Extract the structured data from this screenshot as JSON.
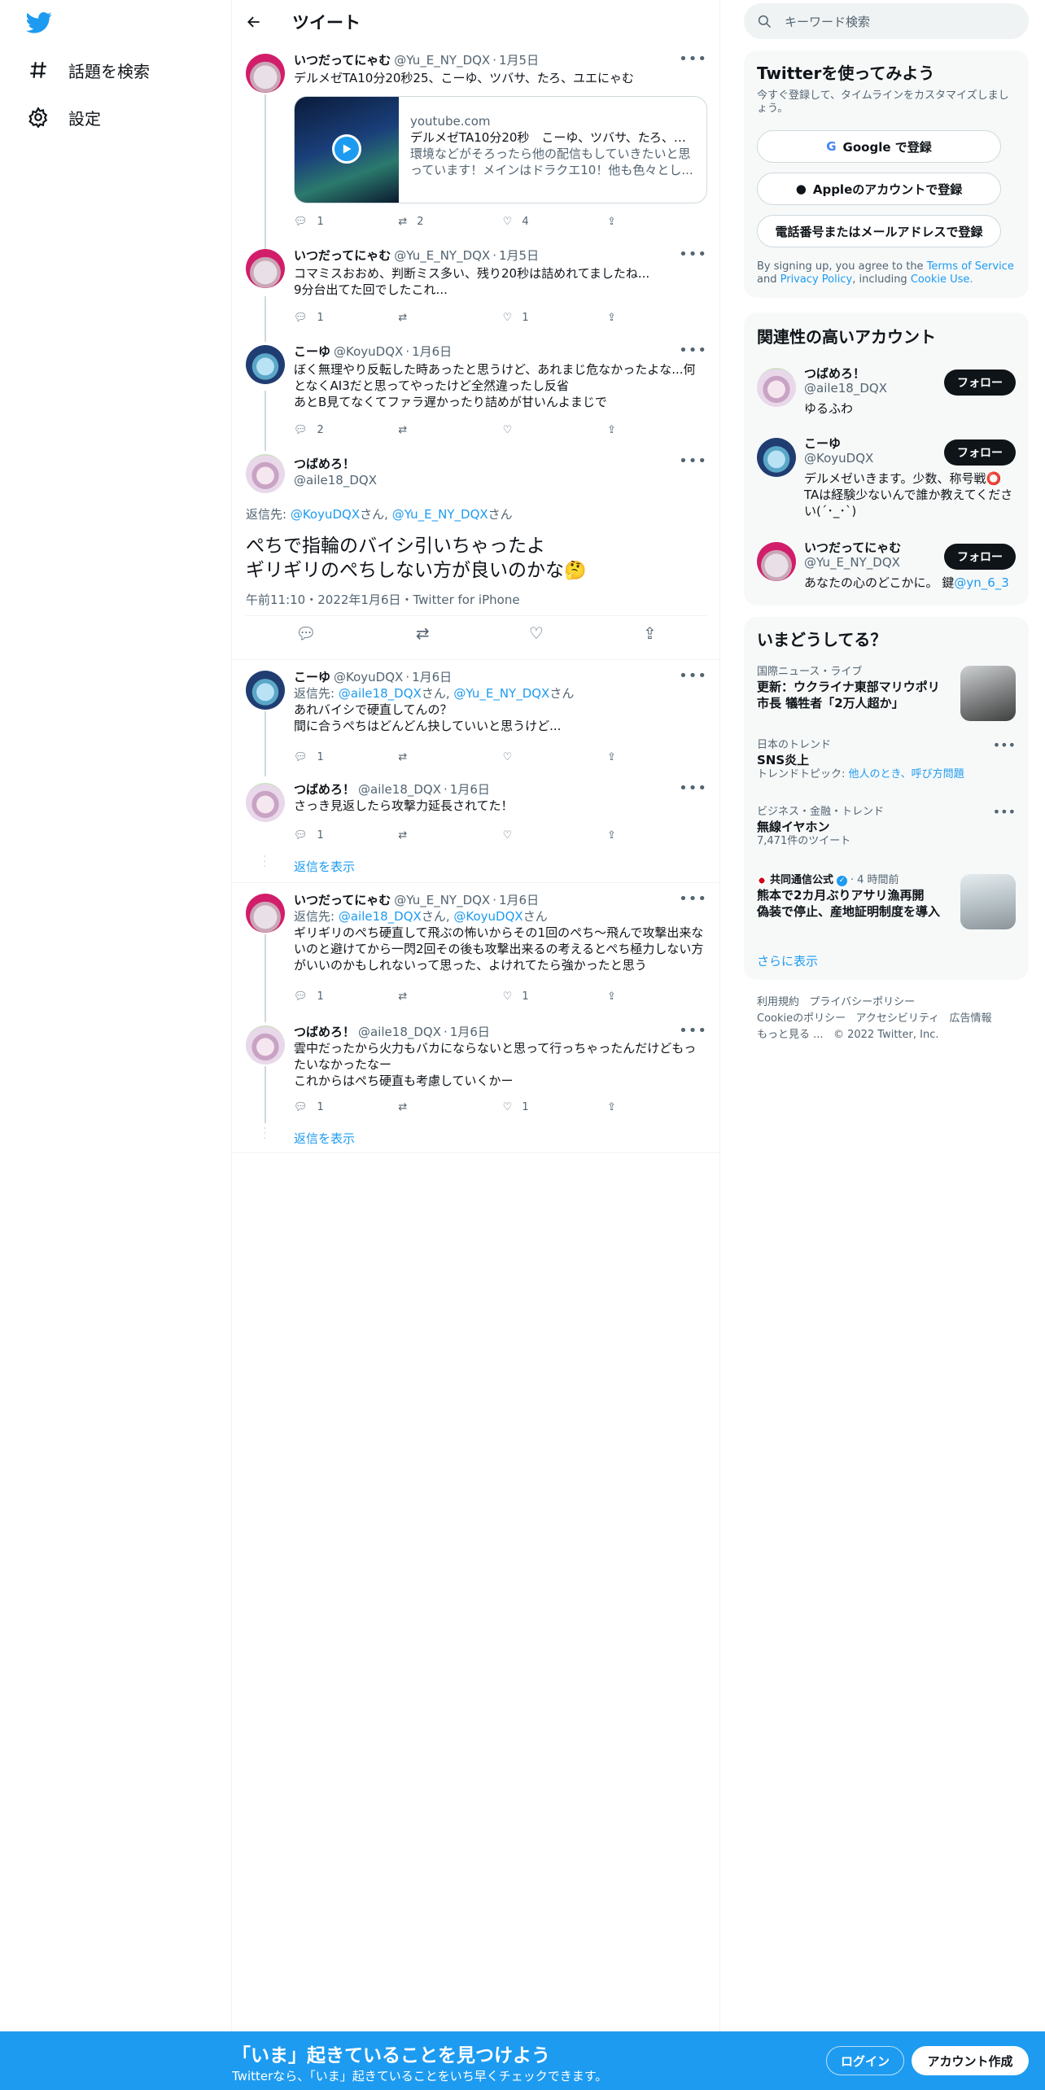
{
  "nav": {
    "explore_label": "話題を検索",
    "settings_label": "設定"
  },
  "header": {
    "title": "ツイート"
  },
  "tweets": [
    {
      "name": "いつだってにゃむ",
      "handle": "@Yu_E_NY_DQX",
      "date": "1月5日",
      "text": "デルメゼTA10分20秒25、こーゆ、ツバサ、たろ、ユエにゃむ",
      "card": {
        "domain": "youtube.com",
        "title": "デルメゼTA10分20秒　こーゆ、ツバサ、たろ、ユ...",
        "desc": "環境などがそろったら他の配信もしていきたいと思っています！メインはドラクエ10！他も色々とし..."
      },
      "replies": "1",
      "retweets": "2",
      "likes": "4"
    },
    {
      "name": "いつだってにゃむ",
      "handle": "@Yu_E_NY_DQX",
      "date": "1月5日",
      "text": "コマミスおおめ、判断ミス多い、残り20秒は詰めれてましたね...\n9分台出てた回でしたこれ...",
      "replies": "1",
      "retweets": "",
      "likes": "1"
    },
    {
      "name": "こーゆ",
      "handle": "@KoyuDQX",
      "date": "1月6日",
      "text": "ぼく無理やり反転した時あったと思うけど、あれまじ危なかったよな...何となくAI3だと思ってやったけど全然違ったし反省\nあとB見てなくてファラ遅かったり詰めが甘いんよまじで",
      "replies": "2",
      "retweets": "",
      "likes": ""
    }
  ],
  "main_tweet": {
    "name": "つばめろ！",
    "handle": "@aile18_DQX",
    "reply_prefix": "返信先:",
    "reply_user1": "@KoyuDQX",
    "reply_san1": "さん,",
    "reply_user2": "@Yu_E_NY_DQX",
    "reply_san2": "さん",
    "text": "ぺちで指輪のバイシ引いちゃったよ\nギリギリのぺちしない方が良いのかな",
    "emoji": "🤔",
    "meta": "午前11:10・2022年1月6日・Twitter for iPhone"
  },
  "replies": [
    {
      "name": "こーゆ",
      "handle": "@KoyuDQX",
      "date": "1月6日",
      "reply_prefix": "返信先:",
      "reply_user1": "@aile18_DQX",
      "reply_san1": "さん,",
      "reply_user2": "@Yu_E_NY_DQX",
      "reply_san2": "さん",
      "text": "あれバイシで硬直してんの？\n間に合うぺちはどんどん抉していいと思うけど...",
      "replies": "1"
    },
    {
      "name": "つばめろ！",
      "handle": "@aile18_DQX",
      "date": "1月6日",
      "text": "さっき見返したら攻撃力延長されてた！",
      "replies": "1"
    },
    {
      "name": "いつだってにゃむ",
      "handle": "@Yu_E_NY_DQX",
      "date": "1月6日",
      "reply_prefix": "返信先:",
      "reply_user1": "@aile18_DQX",
      "reply_san1": "さん,",
      "reply_user2": "@KoyuDQX",
      "reply_san2": "さん",
      "text": "ギリギリのぺち硬直して飛ぶの怖いからその1回のぺち～飛んで攻撃出来ないのと避けてから一閃2回その後も攻撃出来るの考えるとぺち極力しない方がいいのかもしれないって思った、よけれてたら強かったと思う",
      "replies": "1",
      "likes": "1"
    },
    {
      "name": "つばめろ！",
      "handle": "@aile18_DQX",
      "date": "1月6日",
      "text": "雲中だったから火力もバカにならないと思って行っちゃったんだけどもったいなかったなー\nこれからはぺち硬直も考慮していくかー",
      "replies": "1",
      "likes": "1"
    }
  ],
  "show_replies_label": "返信を表示",
  "search": {
    "placeholder": "キーワード検索"
  },
  "signup_panel": {
    "title": "Twitterを使ってみよう",
    "subtitle": "今すぐ登録して、タイムラインをカスタマイズしましょう。",
    "google": "Google で登録",
    "apple": "Appleのアカウントで登録",
    "phone": "電話番号またはメールアドレスで登録",
    "terms_1": "By signing up, you agree to the",
    "terms_link": "Terms of Service",
    "terms_2": "and",
    "privacy_link": "Privacy Policy",
    "terms_3": ", including",
    "cookie_link": "Cookie Use."
  },
  "related": {
    "title": "関連性の高いアカウント",
    "follow_label": "フォロー",
    "accounts": [
      {
        "name": "つばめろ！",
        "handle": "@aile18_DQX",
        "bio": "ゆるふわ"
      },
      {
        "name": "こーゆ",
        "handle": "@KoyuDQX",
        "bio": "デルメゼいきます。少数、称号戦⭕ TAは経験少ないんで誰か教えてください(´･_･`)"
      },
      {
        "name": "いつだってにゃむ",
        "handle": "@Yu_E_NY_DQX",
        "bio": "あなたの心のどこかに。 鍵",
        "bio_link": "@yn_6_3"
      }
    ]
  },
  "trends": {
    "title": "いまどうしてる？",
    "items": [
      {
        "cat": "国際ニュース・ライブ",
        "title": "更新：ウクライナ東部マリウポリ市長 犠牲者「2万人超か」"
      },
      {
        "cat": "日本のトレンド",
        "title": "SNS炎上",
        "sub_prefix": "トレンドトピック:",
        "sub_link": "他人のとき、呼び方問題"
      },
      {
        "cat": "ビジネス・金融・トレンド",
        "title": "無線イヤホン",
        "sub": "7,471件のツイート"
      },
      {
        "source": "共同通信公式",
        "time": "4 時間前",
        "title": "熊本で2カ月ぶりアサリ漁再開　偽装で停止、産地証明制度を導入"
      }
    ],
    "more": "さらに表示"
  },
  "footer": {
    "line1a": "利用規約",
    "line1b": "プライバシーポリシー",
    "line2a": "Cookieのポリシー",
    "line2b": "アクセシビリティ",
    "line2c": "広告情報",
    "line3a": "もっと見る ...",
    "line3b": "© 2022 Twitter, Inc."
  },
  "bottom_bar": {
    "headline": "「いま」起きていることを見つけよう",
    "sub": "Twitterなら、「いま」起きていることをいち早くチェックできます。",
    "login": "ログイン",
    "signup": "アカウント作成"
  },
  "colors": {
    "accent": "#1d9bf0",
    "text": "#0f1419",
    "muted": "#536471"
  }
}
